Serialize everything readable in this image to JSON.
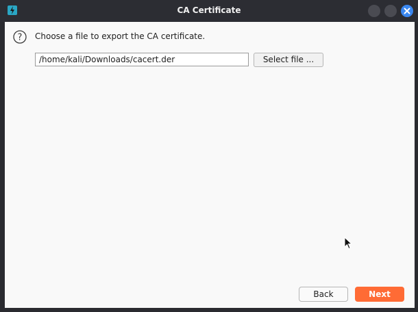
{
  "window": {
    "title": "CA Certificate",
    "app_icon": "lightning-bolt-icon"
  },
  "controls": {
    "minimize": "circle-icon",
    "maximize": "circle-icon",
    "close": "close-x-icon"
  },
  "dialog": {
    "help_icon": "question-mark-icon",
    "prompt": "Choose a file to export the CA certificate.",
    "file_path": "/home/kali/Downloads/cacert.der",
    "select_file_label": "Select file ..."
  },
  "footer": {
    "back_label": "Back",
    "next_label": "Next"
  },
  "colors": {
    "accent": "#ff6b35",
    "close_button": "#3a87f0",
    "app_icon": "#2aa6c4"
  }
}
